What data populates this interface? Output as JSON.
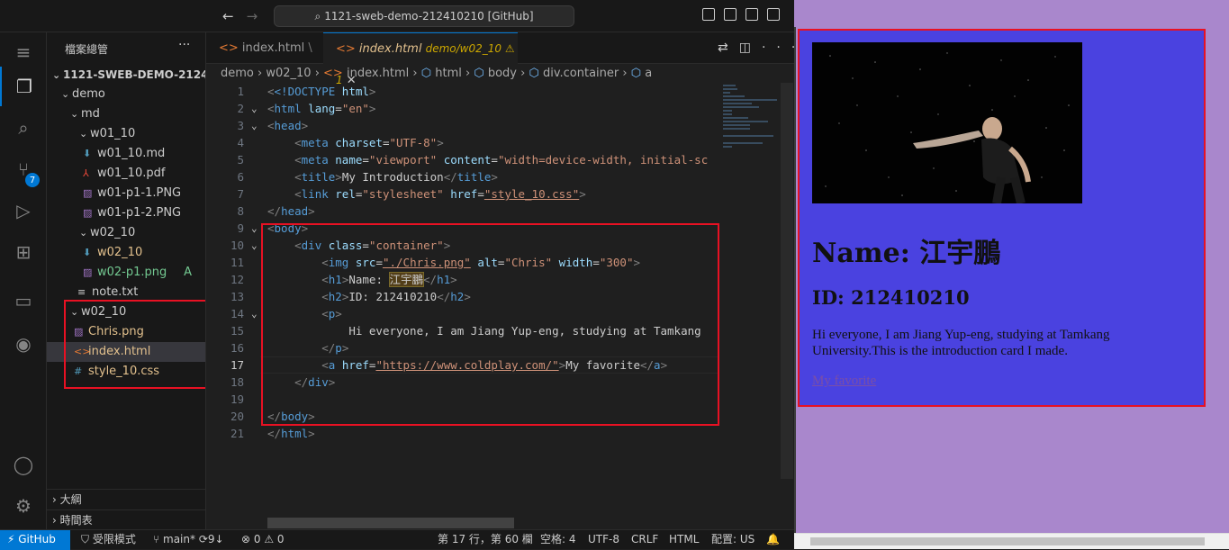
{
  "titlebar": {
    "command_center": "1121-sweb-demo-212410210 [GitHub]"
  },
  "activity": {
    "scm_badge": "7"
  },
  "sidebar": {
    "title": "檔案總管",
    "root": "1121-SWEB-DEMO-2124...",
    "items": [
      {
        "label": "demo"
      },
      {
        "label": "md"
      },
      {
        "label": "w01_10"
      },
      {
        "label": "w01_10.md"
      },
      {
        "label": "w01_10.pdf"
      },
      {
        "label": "w01-p1-1.PNG"
      },
      {
        "label": "w01-p1-2.PNG"
      },
      {
        "label": "w02_10"
      },
      {
        "label": "w02_10"
      },
      {
        "label": "w02-p1.png",
        "git": "A"
      },
      {
        "label": "note.txt"
      },
      {
        "label": "w02_10"
      },
      {
        "label": "Chris.png"
      },
      {
        "label": "index.html"
      },
      {
        "label": "style_10.css"
      }
    ],
    "outline": "大綱",
    "timeline": "時間表"
  },
  "tabs": [
    {
      "label": "index.html",
      "desc": "\\"
    },
    {
      "label": "index.html",
      "desc": "demo/w02_10 ⚠ 1"
    }
  ],
  "breadcrumb": [
    "demo",
    "w02_10",
    "index.html",
    "html",
    "body",
    "div.container",
    "a"
  ],
  "code": {
    "line_numbers": [
      "1",
      "2",
      "3",
      "4",
      "5",
      "6",
      "7",
      "8",
      "9",
      "10",
      "11",
      "12",
      "13",
      "14",
      "15",
      "16",
      "17",
      "18",
      "19",
      "20",
      "21"
    ],
    "l1_doctype": "<!DOCTYPE ",
    "l1_html": "html",
    "l6_title_text": "My Introduction",
    "l7_href": "\"style_10.css\"",
    "l11_src": "\"./Chris.png\"",
    "l11_alt": "\"Chris\"",
    "l11_width": "\"300\"",
    "l12_name": "Name: ",
    "l12_chinese": "江宇鵬",
    "l13_text": "ID: 212410210",
    "l15_text": "Hi everyone, I am Jiang Yup-eng, studying at Tamkang",
    "l17_href": "\"https://www.coldplay.com/\"",
    "l17_text": "My favorite",
    "l5_content": "\"width=device-width, initial-sc"
  },
  "status": {
    "remote": "GitHub",
    "restricted": "受限模式",
    "branch": "main*",
    "sync": "9↓",
    "problems": "⊗ 0 ⚠ 0",
    "position": "第 17 行，第 60 欄",
    "spaces": "空格: 4",
    "encoding": "UTF-8",
    "eol": "CRLF",
    "language": "HTML",
    "config": "配置: US"
  },
  "preview": {
    "name_heading": "Name: 江宇鵬",
    "id_heading": "ID: 212410210",
    "paragraph": "Hi everyone, I am Jiang Yup-eng, studying at Tamkang University.This is the introduction card I made.",
    "link": "My favorite",
    "image_alt": "Chris"
  },
  "colors": {
    "accent": "#0078d4",
    "highlight_box": "#e81123",
    "preview_bg": "#a987cc",
    "card_bg": "#4a42e0"
  }
}
